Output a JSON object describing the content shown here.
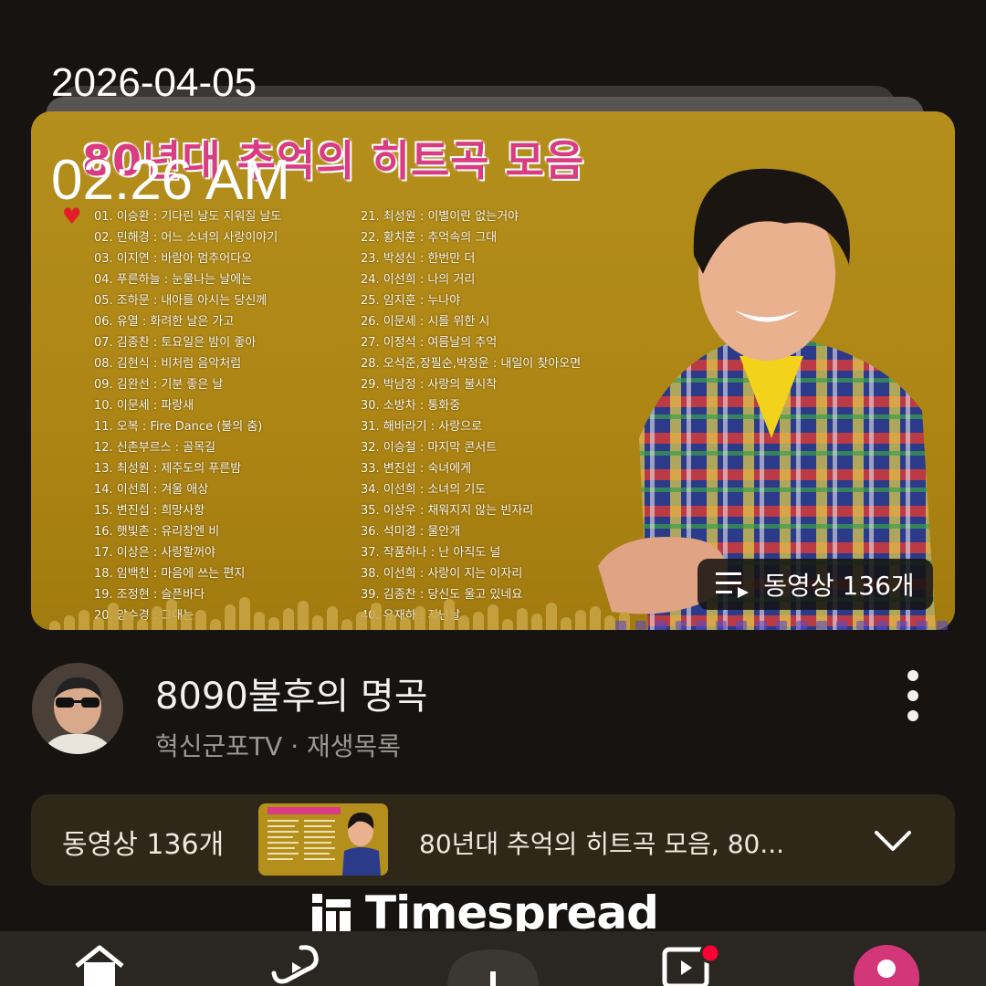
{
  "overlay": {
    "date": "2026-04-05",
    "time": "02:26 AM"
  },
  "thumbnail": {
    "title": "80년대 추억의 히트곡 모음",
    "badge_count": "동영상 136개",
    "songs_left": [
      "01. 이승환 : 기다린 날도 지워질 날도",
      "02. 민해경 : 어느 소녀의 사랑이야기",
      "03. 이지연 : 바람아 멈추어다오",
      "04. 푸른하늘 : 눈물나는 날에는",
      "05. 조하문 : 내아를 아시는 당신께",
      "06. 유열 : 화려한 날은 가고",
      "07. 김종찬 : 토요일은 밤이 좋아",
      "08. 김현식 : 비처럼 음악처럼",
      "09. 김완선 : 기분 좋은 날",
      "10. 이문세 : 파랑새",
      "11. 오복 : Fire Dance (불의 춤)",
      "12. 신촌부르스 : 골목길",
      "13. 최성원 : 제주도의 푸른밤",
      "14. 이선희 : 겨울 애상",
      "15. 변진섭 : 희망사항",
      "16. 햇빛촌 : 유리창엔 비",
      "17. 이상은 : 사랑할꺼야",
      "18. 임백천 : 마음에 쓰는 편지",
      "19. 조정현 : 슬픈바다",
      "20. 양수경 : 그대는"
    ],
    "songs_right": [
      "21. 최성원 : 이별이란 없는거야",
      "22. 황치훈 : 추억속의 그대",
      "23. 박성신 : 한번만 더",
      "24. 이선희 : 나의 거리",
      "25. 임지훈 : 누나야",
      "26. 이문세 : 시를 위한 시",
      "27. 이정석 : 여름날의 추억",
      "28. 오석준,장필순,박정운 : 내일이 찾아오면",
      "29. 박남정 : 사랑의 불시착",
      "30. 소방차 : 통화중",
      "31. 해바라기 : 사랑으로",
      "32. 이승철 : 마지막 콘서트",
      "33. 변진섭 : 숙녀에게",
      "34. 이선희 : 소녀의 기도",
      "35. 이상우 : 채워지지 않는 빈자리",
      "36. 석미경 : 물안개",
      "37. 작품하나 : 난 아직도 널",
      "38. 이선희 : 사랑이 지는 이자리",
      "39. 김종찬 : 당신도 울고 있네요",
      "40. 유재하 : 지난날"
    ]
  },
  "playlist": {
    "title": "8090불후의 명곡",
    "subtitle": "혁신군포TV · 재생목록"
  },
  "queue": {
    "count_label": "동영상 136개",
    "current_title": "80년대 추억의 히트곡 모음, 80..."
  },
  "watermark": {
    "text": "Timespread"
  },
  "nav": {
    "items": [
      "home-icon",
      "shorts-icon",
      "create-icon",
      "subscriptions-icon",
      "profile-icon"
    ],
    "notification_color": "#ff0033"
  },
  "colors": {
    "background": "#161310",
    "thumbnail_bg": "#b48f1c",
    "queue_bg": "#2f2718",
    "title_pink": "#d93c80"
  }
}
